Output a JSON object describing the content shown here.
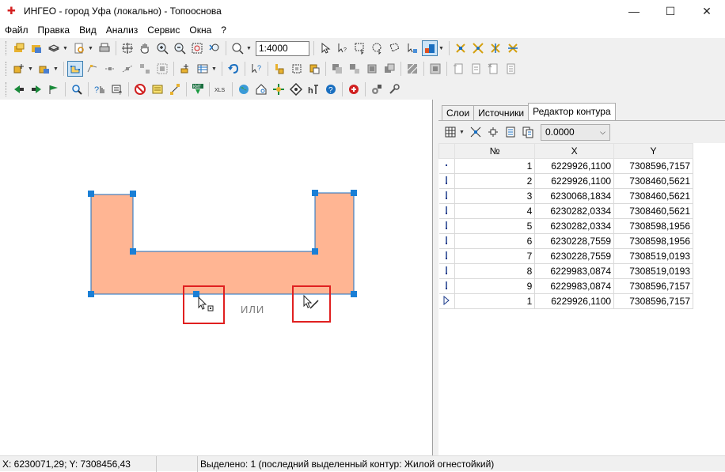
{
  "window": {
    "title": "ИНГЕО - город Уфа (локально) - Топооснова",
    "minimize": "—",
    "maximize": "☐",
    "close": "✕"
  },
  "menu": [
    "Файл",
    "Правка",
    "Вид",
    "Анализ",
    "Сервис",
    "Окна",
    "?"
  ],
  "toolbar": {
    "scale": "1:4000"
  },
  "map": {
    "or_label": "ИЛИ"
  },
  "panel": {
    "tabs": [
      {
        "label": "Слои",
        "active": false
      },
      {
        "label": "Источники",
        "active": false
      },
      {
        "label": "Редактор контура",
        "active": true
      }
    ],
    "value_select": "0.0000",
    "table": {
      "headers": [
        "№",
        "X",
        "Y"
      ],
      "rows": [
        {
          "n": "1",
          "x": "6229926,1100",
          "y": "7308596,7157"
        },
        {
          "n": "2",
          "x": "6229926,1100",
          "y": "7308460,5621"
        },
        {
          "n": "3",
          "x": "6230068,1834",
          "y": "7308460,5621"
        },
        {
          "n": "4",
          "x": "6230282,0334",
          "y": "7308460,5621"
        },
        {
          "n": "5",
          "x": "6230282,0334",
          "y": "7308598,1956"
        },
        {
          "n": "6",
          "x": "6230228,7559",
          "y": "7308598,1956"
        },
        {
          "n": "7",
          "x": "6230228,7559",
          "y": "7308519,0193"
        },
        {
          "n": "8",
          "x": "6229983,0874",
          "y": "7308519,0193"
        },
        {
          "n": "9",
          "x": "6229983,0874",
          "y": "7308596,7157"
        },
        {
          "n": "1",
          "x": "6229926,1100",
          "y": "7308596,7157"
        }
      ]
    }
  },
  "status": {
    "coords": "X: 6230071,29; Y: 7308456,43",
    "selection": "Выделено: 1 (последний выделенный контур: Жилой огнестойкий)"
  },
  "colors": {
    "polygon_fill": "#ffb593",
    "handle": "#1a7fd6",
    "highlight": "#e02020"
  }
}
